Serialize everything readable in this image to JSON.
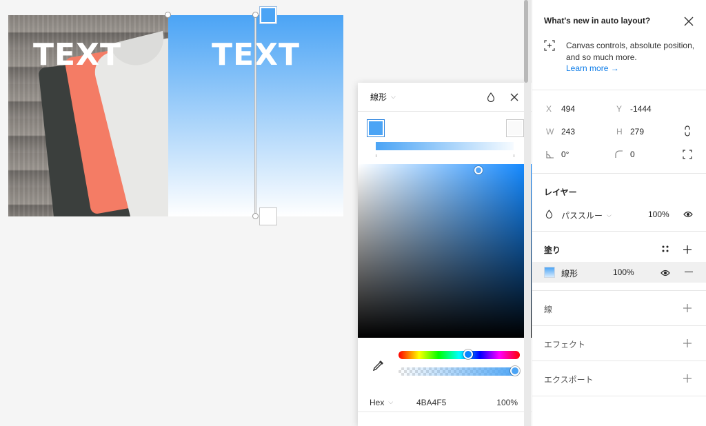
{
  "canvas": {
    "photo_text": "TEXT",
    "gradient_text": "TEXT",
    "gradient_start": "#4BA4F5",
    "gradient_end": "#FFFFFF"
  },
  "picker": {
    "type_label": "線形",
    "hex_mode": "Hex",
    "hex_value": "4BA4F5",
    "opacity": "100%"
  },
  "whats_new": {
    "title": "What's new in auto layout?",
    "description": "Canvas controls, absolute position, and so much more.",
    "link": "Learn more →"
  },
  "geometry": {
    "x_label": "X",
    "x_value": "494",
    "y_label": "Y",
    "y_value": "-1444",
    "w_label": "W",
    "w_value": "243",
    "h_label": "H",
    "h_value": "279",
    "rotation_value": "0°",
    "radius_value": "0"
  },
  "layer": {
    "title": "レイヤー",
    "blend_mode": "パススルー",
    "opacity": "100%"
  },
  "fill": {
    "title": "塗り",
    "item_label": "線形",
    "item_opacity": "100%"
  },
  "stroke": {
    "title": "線"
  },
  "effects": {
    "title": "エフェクト"
  },
  "export": {
    "title": "エクスポート"
  },
  "colors": {
    "accent": "#0d7ce8",
    "gradient_blue": "#4BA4F5"
  }
}
